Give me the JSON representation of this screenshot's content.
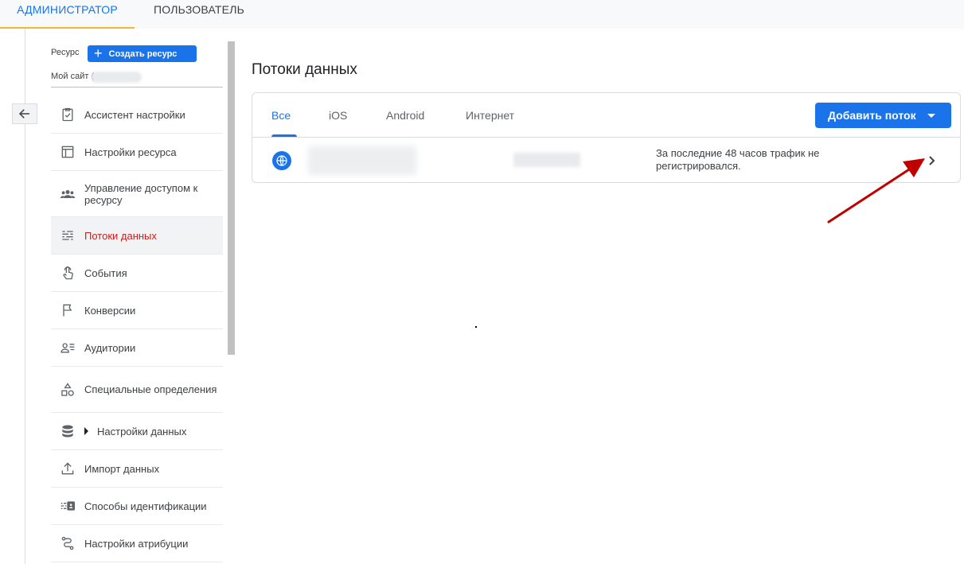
{
  "top_tabs": {
    "admin": "АДМИНИСТРАТОР",
    "user": "ПОЛЬЗОВАТЕЛЬ"
  },
  "sidebar": {
    "resource_label": "Ресурс",
    "create_button": "Создать ресурс",
    "site_label": "Мой сайт (",
    "items": [
      {
        "label": "Ассистент настройки",
        "icon": "checklist-icon"
      },
      {
        "label": "Настройки ресурса",
        "icon": "layout-icon"
      },
      {
        "label": "Управление доступом к ресурсу",
        "icon": "people-icon"
      },
      {
        "label": "Потоки данных",
        "icon": "data-streams-icon",
        "active": true
      },
      {
        "label": "События",
        "icon": "touch-icon"
      },
      {
        "label": "Конверсии",
        "icon": "flag-icon"
      },
      {
        "label": "Аудитории",
        "icon": "audience-icon"
      },
      {
        "label": "Специальные определения",
        "icon": "shapes-icon"
      },
      {
        "label": "Настройки данных",
        "icon": "database-icon",
        "expandable": true
      },
      {
        "label": "Импорт данных",
        "icon": "upload-icon"
      },
      {
        "label": "Способы идентификации",
        "icon": "id-card-icon"
      },
      {
        "label": "Настройки атрибуции",
        "icon": "attribution-icon"
      }
    ]
  },
  "main": {
    "title": "Потоки данных",
    "tabs": [
      "Все",
      "iOS",
      "Android",
      "Интернет"
    ],
    "active_tab": "Все",
    "add_button": "Добавить поток",
    "stream_row": {
      "icon": "globe-icon",
      "status": "За последние 48 часов трафик не регистрировался."
    }
  },
  "colors": {
    "accent": "#1a73e8",
    "active_nav": "#c5221f",
    "tab_indicator": "#f2b632",
    "annotation_arrow": "#c00000"
  }
}
